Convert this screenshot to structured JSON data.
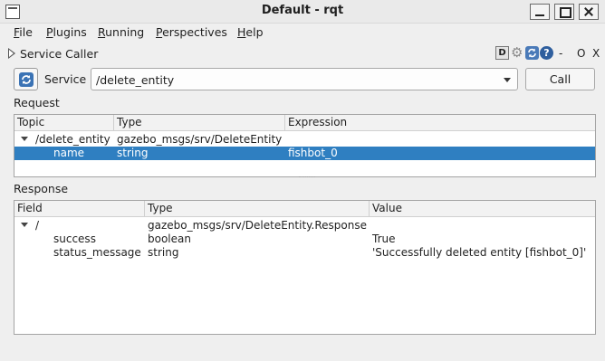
{
  "window": {
    "title": "Default - rqt"
  },
  "menu": [
    {
      "underline": "F",
      "rest": "ile"
    },
    {
      "underline": "P",
      "rest": "lugins"
    },
    {
      "underline": "R",
      "rest": "unning"
    },
    {
      "underline": "P",
      "rest": "erspectives"
    },
    {
      "underline": "H",
      "rest": "elp"
    }
  ],
  "plugin": {
    "title": "Service Caller",
    "icons": {
      "d": "D",
      "help": "?"
    },
    "controls": {
      "dash": "-",
      "restore": "O",
      "close": "X"
    }
  },
  "service": {
    "label": "Service",
    "selected": "/delete_entity",
    "call_label": "Call"
  },
  "request": {
    "label": "Request",
    "columns": [
      "Topic",
      "Type",
      "Expression"
    ],
    "rows": [
      {
        "topic": "/delete_entity",
        "type": "gazebo_msgs/srv/DeleteEntity",
        "expression": ""
      },
      {
        "topic": "name",
        "type": "string",
        "expression": "fishbot_0"
      }
    ]
  },
  "response": {
    "label": "Response",
    "columns": [
      "Field",
      "Type",
      "Value"
    ],
    "rows": [
      {
        "field": "/",
        "type": "gazebo_msgs/srv/DeleteEntity.Response",
        "value": ""
      },
      {
        "field": "success",
        "type": "boolean",
        "value": "True"
      },
      {
        "field": "status_message",
        "type": "string",
        "value": "'Successfully deleted entity [fishbot_0]'"
      }
    ]
  },
  "colors": {
    "selection": "#2f7fc1",
    "accent": "#3b73b5"
  }
}
